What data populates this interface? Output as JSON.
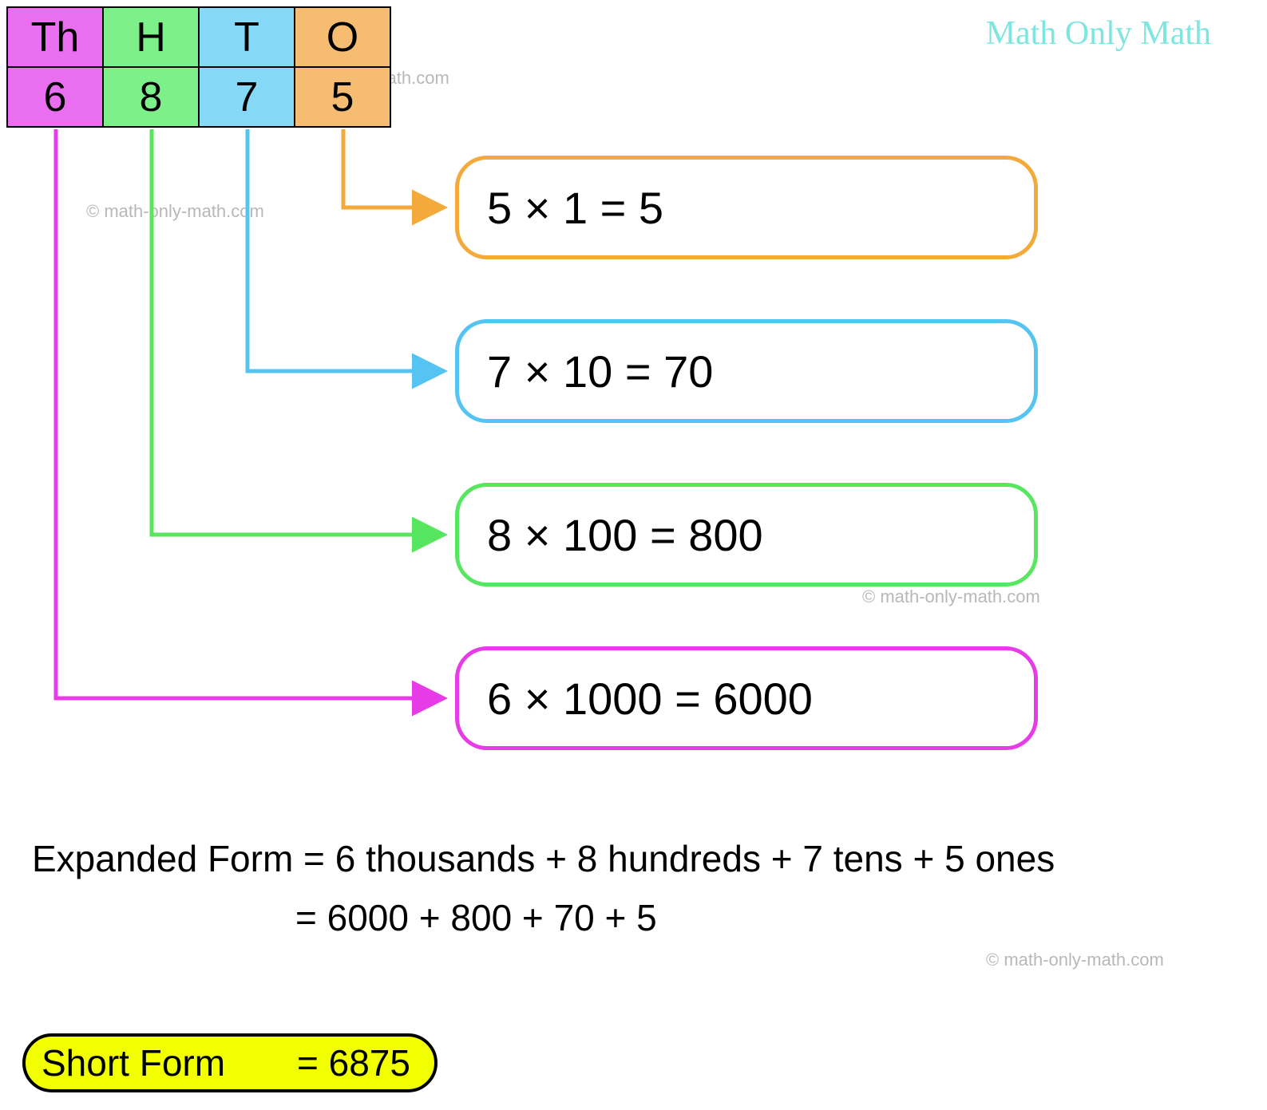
{
  "brand": "Math Only Math",
  "watermark": "© math-only-math.com",
  "place_value": {
    "columns": [
      {
        "label": "Th",
        "digit": "6",
        "color": "#ea6ef0"
      },
      {
        "label": "H",
        "digit": "8",
        "color": "#7ef089"
      },
      {
        "label": "T",
        "digit": "7",
        "color": "#86d8f7"
      },
      {
        "label": "O",
        "digit": "5",
        "color": "#f6bd72"
      }
    ]
  },
  "expressions": {
    "ones": "5 × 1 = 5",
    "tens": "7 × 10 = 70",
    "hundreds": "8 × 100 = 800",
    "thousands": "6 × 1000 = 6000"
  },
  "arrow_colors": {
    "ones": "#f4a93b",
    "tens": "#56c4f2",
    "hundreds": "#57e65f",
    "thousands": "#e83be8"
  },
  "expanded_form": {
    "line1": "Expanded Form = 6 thousands + 8 hundreds + 7 tens + 5 ones",
    "line2": "= 6000 + 800 + 70 + 5"
  },
  "short_form": {
    "label": "Short Form",
    "value": "= 6875"
  }
}
